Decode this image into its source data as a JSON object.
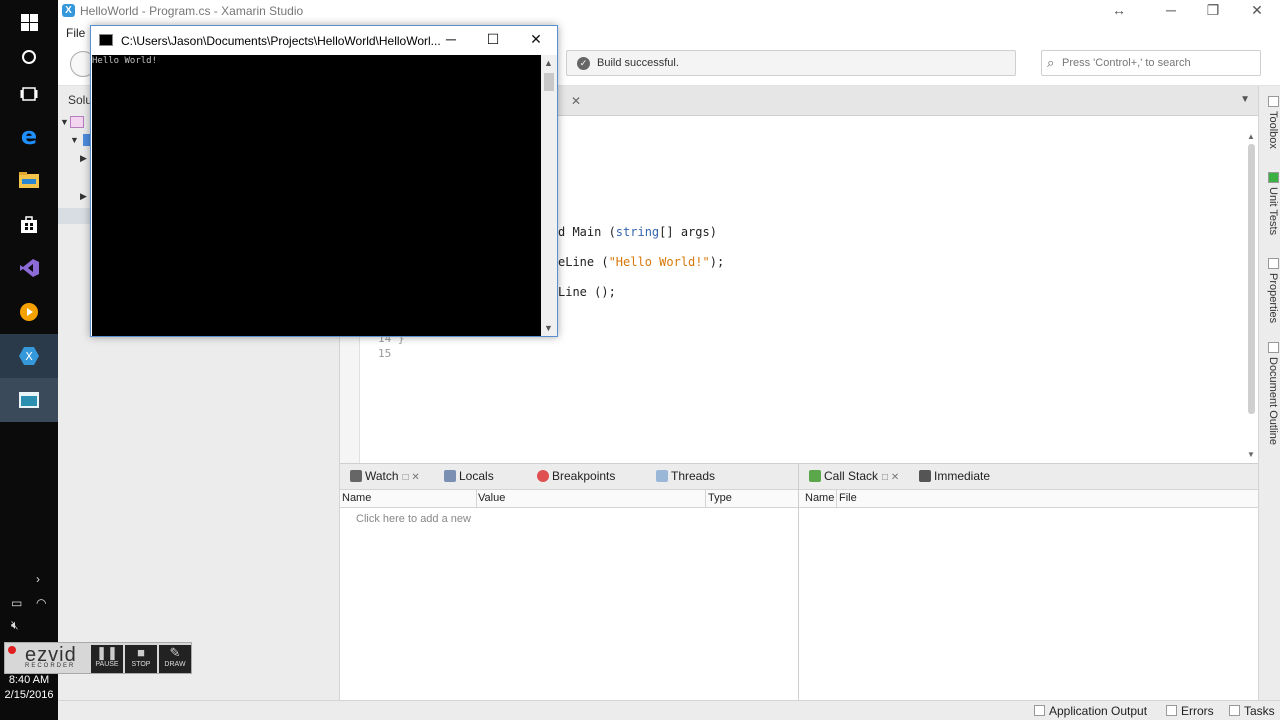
{
  "window": {
    "title": "HelloWorld - Program.cs - Xamarin Studio",
    "resize_glyph": "↔",
    "minimize": "─",
    "maximize": "❐",
    "close": "✕"
  },
  "menu": {
    "file": "File"
  },
  "toolbar": {
    "build_status": "Build successful.",
    "search_placeholder": "Press 'Control+,' to search"
  },
  "solution_pad": {
    "header": "Solu"
  },
  "editor": {
    "lines": [
      {
        "text_pre": "d Main (",
        "kw": "string",
        "text_post": "[] args)"
      },
      {
        "text_pre": "eLine (",
        "str": "\"Hello World!\"",
        "text_post": ");"
      },
      {
        "text_pre": "Line ();",
        "str": "",
        "text_post": ""
      }
    ],
    "line_14": "14 }",
    "line_15": "15"
  },
  "right_dock": [
    "Toolbox",
    "Unit Tests",
    "Properties",
    "Document Outline"
  ],
  "watch_pad": {
    "tabs": [
      "Watch",
      "Locals",
      "Breakpoints",
      "Threads"
    ],
    "columns": [
      "Name",
      "Value",
      "Type"
    ],
    "hint": "Click here to add a new"
  },
  "callstack_pad": {
    "tabs": [
      "Call Stack",
      "Immediate"
    ],
    "columns": [
      "Name",
      "File"
    ]
  },
  "statusbar": [
    "Application Output",
    "Errors",
    "Tasks"
  ],
  "console": {
    "title": "C:\\Users\\Jason\\Documents\\Projects\\HelloWorld\\HelloWorl...",
    "output": "Hello World!",
    "minimize": "─",
    "maximize": "☐",
    "close": "✕"
  },
  "taskbar": {
    "time": "8:40 AM",
    "date": "2/15/2016"
  },
  "recorder": {
    "brand": "ezvid",
    "sub": "RECORDER",
    "buttons": [
      "PAUSE",
      "STOP",
      "DRAW"
    ]
  }
}
